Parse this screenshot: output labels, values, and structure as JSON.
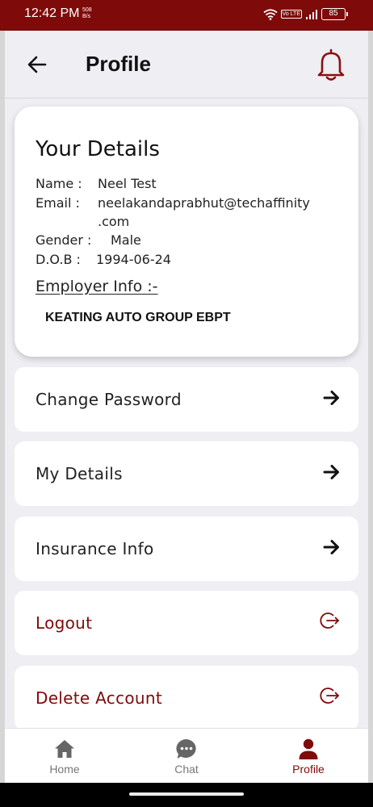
{
  "status_bar": {
    "time": "12:42 PM",
    "speed_value": "508",
    "speed_unit": "B/s",
    "volte": "Vo LTE",
    "battery": "85"
  },
  "header": {
    "title": "Profile",
    "back_icon": "arrow-left-icon",
    "notification_icon": "bell-icon"
  },
  "details": {
    "heading": "Your Details",
    "name_label": "Name :",
    "name_value": "Neel Test",
    "email_label": "Email :",
    "email_value_line1": "neelakandaprabhut@techaffinity",
    "email_value_line2": ".com",
    "gender_label": "Gender :",
    "gender_value": "Male",
    "dob_label": "D.O.B :",
    "dob_value": "1994-06-24",
    "employer_label": "Employer Info :-",
    "employer_name": "KEATING AUTO GROUP EBPT"
  },
  "menu": [
    {
      "label": "Change Password",
      "icon": "arrow-right-icon"
    },
    {
      "label": "My Details",
      "icon": "arrow-right-icon"
    },
    {
      "label": "Insurance Info",
      "icon": "arrow-right-icon"
    },
    {
      "label": "Logout",
      "icon": "exit-icon"
    },
    {
      "label": "Delete Account",
      "icon": "exit-icon"
    }
  ],
  "bottom_nav": [
    {
      "label": "Home",
      "icon": "home-icon",
      "active": false
    },
    {
      "label": "Chat",
      "icon": "chat-icon",
      "active": false
    },
    {
      "label": "Profile",
      "icon": "user-icon",
      "active": true
    }
  ],
  "colors": {
    "brand": "#7f0a0a",
    "background": "#eeeef3",
    "card": "#ffffff"
  }
}
